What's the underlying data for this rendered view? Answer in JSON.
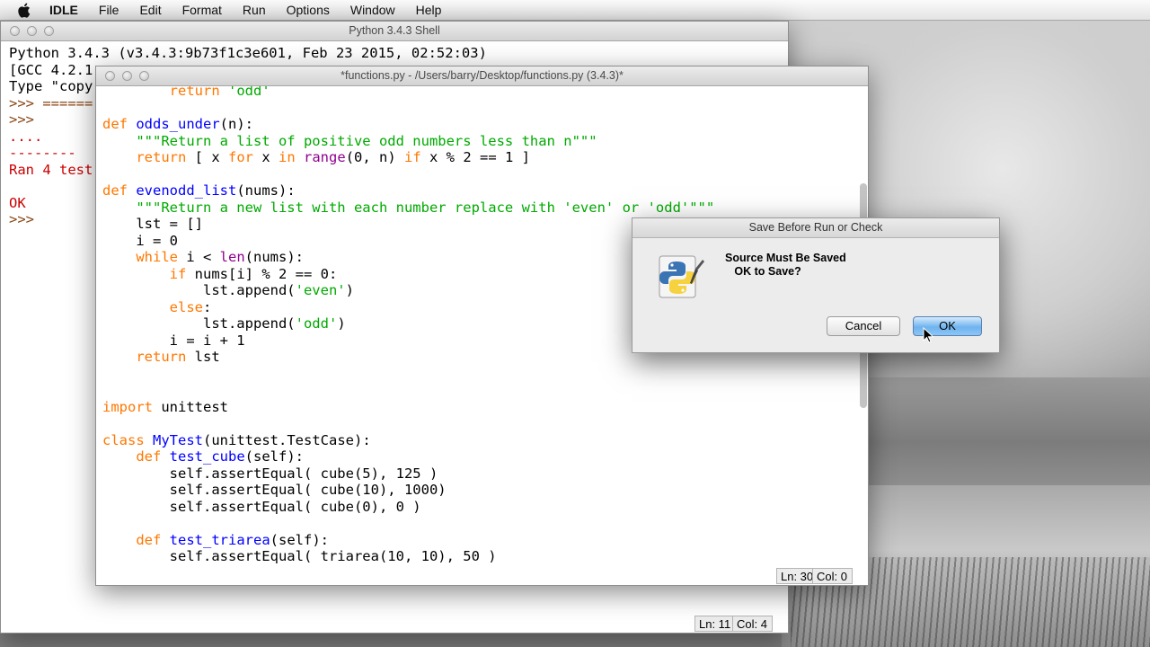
{
  "menubar": {
    "app": "IDLE",
    "items": [
      "File",
      "Edit",
      "Format",
      "Run",
      "Options",
      "Window",
      "Help"
    ]
  },
  "shell": {
    "title": "Python 3.4.3 Shell",
    "lines": [
      "Python 3.4.3 (v3.4.3:9b73f1c3e601, Feb 23 2015, 02:52:03)",
      "[GCC 4.2.1",
      "Type \"copy",
      ">>> ======",
      ">>>",
      "....",
      "--------",
      "Ran 4 test",
      "",
      "OK",
      ">>>"
    ],
    "status": {
      "line": "Ln: 11",
      "col": "Col: 4"
    }
  },
  "editor": {
    "title": "*functions.py - /Users/barry/Desktop/functions.py (3.4.3)*",
    "status": {
      "line": "Ln: 30",
      "col": "Col: 0"
    }
  },
  "dialog": {
    "title": "Save Before Run or Check",
    "message_line1": "Source Must Be Saved",
    "message_line2": "OK to Save?",
    "cancel_label": "Cancel",
    "ok_label": "OK"
  },
  "colors": {
    "keyword": "#ff7700",
    "definition": "#0000ff",
    "string": "#00aa00",
    "builtin": "#900090",
    "error": "#cc0000"
  }
}
